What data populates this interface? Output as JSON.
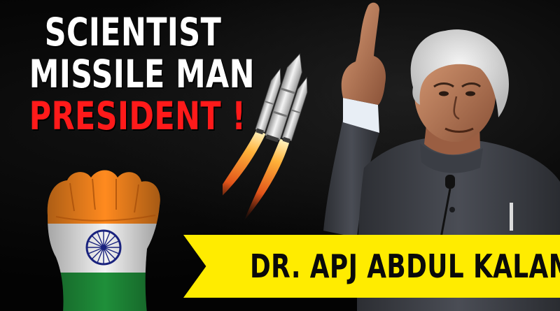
{
  "headline": {
    "line1": "SCIENTIST",
    "line2": "MISSILE MAN",
    "line3": "PRESIDENT !",
    "text_color": "#ffffff",
    "accent_color": "#ff1a1a"
  },
  "banner": {
    "name": "DR. APJ ABDUL KALAM",
    "background_color": "#ffec00",
    "text_color": "#0a0a0a"
  },
  "illustrations": {
    "rocket": "rocket-launch-icon",
    "fist": "raised-fist-indian-flag",
    "flag_colors": [
      "#ff8a1f",
      "#ffffff",
      "#1f8f3a"
    ],
    "chakra_color": "#1a237e",
    "portrait": "speaker-pointing-up"
  },
  "background_color": "#030303"
}
